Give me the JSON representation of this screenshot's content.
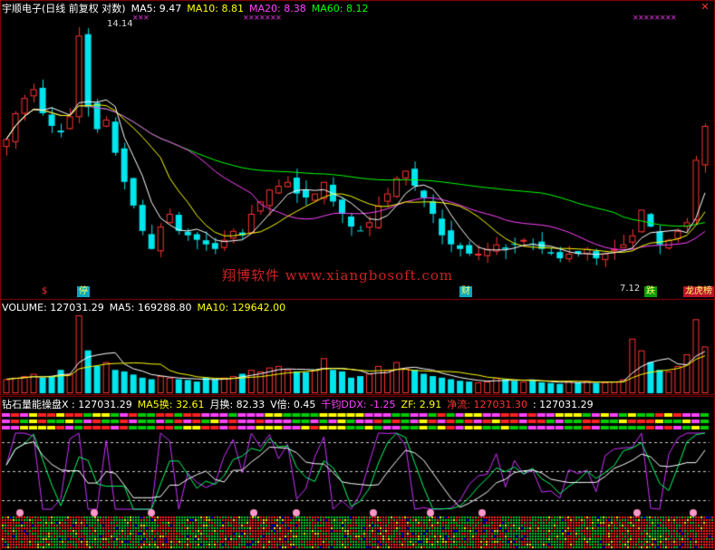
{
  "header_price": {
    "title": "宇顺电子(日线 前复权 对数)",
    "ma5": "MA5: 9.47",
    "ma10": "MA10: 8.81",
    "ma20": "MA20: 8.38",
    "ma60": "MA60: 8.12"
  },
  "header_volume": {
    "volume": "VOLUME: 127031.29",
    "ma5": "MA5: 169288.80",
    "ma10": "MA10: 129642.00"
  },
  "header_indicator": {
    "name": "钻石量能操盘X : 127031.29",
    "ma5_turnover": "MA5换: 32.61",
    "month_turnover": "月换: 82.33",
    "v_ratio": "V倍: 0.45",
    "ddx": "千钧DDX: -1.25",
    "zf": "ZF: 2.91",
    "net_flow": "净流: 127031.30",
    "tail": ": 127031.29"
  },
  "watermark": "翔博软件 www.xiangbosoft.com",
  "annotations": {
    "high_label": "14.14",
    "low_label": "7.12",
    "tag_ting": "停",
    "tag_cai": "财",
    "tag_die": "跌",
    "tag_bang": "龙虎榜",
    "red_marker": "$"
  },
  "colors": {
    "up": "#ff3333",
    "down": "#00e5ee",
    "ma5": "#ffffff",
    "ma10": "#ffff00",
    "ma20": "#ff44ff",
    "ma60": "#00ff00",
    "grid": "#8b0000"
  },
  "chart_data": [
    {
      "type": "candlestick",
      "title": "宇顺电子(日线 前复权 对数)",
      "scale": "log",
      "annotated_high": 14.14,
      "annotated_low": 7.12,
      "approx_close_path": [
        10.2,
        11.0,
        11.5,
        11.8,
        11.0,
        10.6,
        10.4,
        10.9,
        13.8,
        11.2,
        10.5,
        10.8,
        9.8,
        9.0,
        8.4,
        7.8,
        7.4,
        7.9,
        8.2,
        7.8,
        7.7,
        7.6,
        7.5,
        7.4,
        7.6,
        7.8,
        7.7,
        8.2,
        8.5,
        8.8,
        8.9,
        9.0,
        8.7,
        8.6,
        8.7,
        9.0,
        8.5,
        8.2,
        7.9,
        7.8,
        8.0,
        8.4,
        8.7,
        9.1,
        9.3,
        8.9,
        8.6,
        8.2,
        7.7,
        7.5,
        7.4,
        7.3,
        7.3,
        7.4,
        7.5,
        7.4,
        7.5,
        7.6,
        7.5,
        7.4,
        7.3,
        7.2,
        7.3,
        7.3,
        7.4,
        7.2,
        7.3,
        7.4,
        7.5,
        7.7,
        8.3,
        7.9,
        7.5,
        7.6,
        7.8,
        8.0,
        9.6,
        10.6
      ],
      "series": [
        {
          "name": "MA5",
          "last": 9.47
        },
        {
          "name": "MA10",
          "last": 8.81
        },
        {
          "name": "MA20",
          "last": 8.38
        },
        {
          "name": "MA60",
          "last": 8.12
        }
      ]
    },
    {
      "type": "bar",
      "title": "VOLUME",
      "last": 127031.29,
      "series": [
        {
          "name": "MA5",
          "last": 169288.8
        },
        {
          "name": "MA10",
          "last": 129642.0
        }
      ],
      "relative_values": [
        0.18,
        0.2,
        0.22,
        0.25,
        0.2,
        0.22,
        0.3,
        0.25,
        1.0,
        0.55,
        0.35,
        0.4,
        0.3,
        0.28,
        0.24,
        0.2,
        0.18,
        0.22,
        0.2,
        0.18,
        0.17,
        0.15,
        0.2,
        0.18,
        0.2,
        0.22,
        0.25,
        0.3,
        0.28,
        0.33,
        0.35,
        0.3,
        0.28,
        0.27,
        0.3,
        0.45,
        0.3,
        0.28,
        0.2,
        0.22,
        0.25,
        0.35,
        0.3,
        0.4,
        0.32,
        0.3,
        0.25,
        0.22,
        0.2,
        0.18,
        0.16,
        0.15,
        0.14,
        0.15,
        0.2,
        0.18,
        0.16,
        0.15,
        0.17,
        0.14,
        0.13,
        0.12,
        0.15,
        0.14,
        0.16,
        0.13,
        0.14,
        0.15,
        0.18,
        0.7,
        0.55,
        0.4,
        0.3,
        0.28,
        0.35,
        0.5,
        0.95,
        0.6
      ]
    },
    {
      "type": "line",
      "title": "钻石量能操盘X",
      "series": [
        {
          "name": "紫线"
        },
        {
          "name": "绿线"
        },
        {
          "name": "白线"
        }
      ]
    }
  ]
}
